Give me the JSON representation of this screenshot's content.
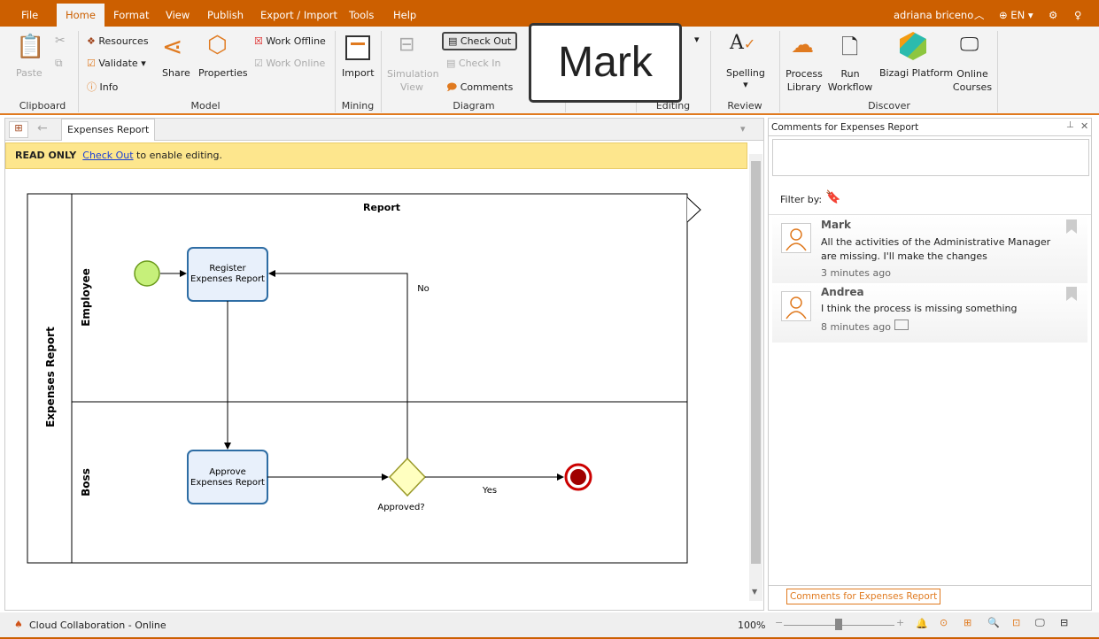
{
  "menu": {
    "file": "File",
    "tabs": [
      "Home",
      "Format",
      "View",
      "Publish",
      "Export / Import",
      "Tools",
      "Help"
    ],
    "user": "adriana briceno",
    "language": "EN"
  },
  "ribbon": {
    "paste": "Paste",
    "clipboard_group": "Clipboard",
    "resources": "Resources",
    "validate": "Validate",
    "info": "Info",
    "share": "Share",
    "properties": "Properties",
    "work_offline": "Work Offline",
    "work_online": "Work Online",
    "model_group": "Model",
    "import": "Import",
    "mining_group": "Mining",
    "simulation_view": "Simulation View",
    "check_out": "Check Out",
    "check_in": "Check In",
    "comments": "Comments",
    "diagram_group": "Diagram",
    "editing_group": "Editing",
    "spelling": "Spelling",
    "review_group": "Review",
    "process_library": "Process Library",
    "run_workflow": "Run Workflow",
    "bizagi_platform": "Bizagi Platform",
    "online_courses": "Online Courses",
    "discover_group": "Discover"
  },
  "tooltip": {
    "text": "Mark"
  },
  "document": {
    "tab": "Expenses Report",
    "readonly_label": "READ ONLY",
    "readonly_link": "Check Out",
    "readonly_suffix": " to enable editing."
  },
  "diagram": {
    "pool": "Expenses Report",
    "header": "Report",
    "lanes": [
      "Employee",
      "Boss"
    ],
    "task1": [
      "Register",
      "Expenses Report"
    ],
    "task2": [
      "Approve",
      "Expenses Report"
    ],
    "gateway": "Approved?",
    "no": "No",
    "yes": "Yes"
  },
  "comments_panel": {
    "title": "Comments for Expenses Report",
    "filter_label": "Filter by:",
    "items": [
      {
        "author": "Mark",
        "text": "All the activities of the Administrative Manager are missing. I'll make the changes",
        "time": "3 minutes ago"
      },
      {
        "author": "Andrea",
        "text": "I think the process is missing something",
        "time": "8 minutes ago"
      }
    ],
    "bottom_tab": "Comments for Expenses Report"
  },
  "status": {
    "cloud": "Cloud Collaboration - Online",
    "zoom": "100%",
    "zoom_level": 100
  },
  "colors": {
    "brand": "#cc5f00",
    "readonly_bg": "#fde68d",
    "task_fill": "#e8f0fb",
    "task_border": "#2e6da4",
    "start": "#c6f07a",
    "end": "#a00000",
    "gateway": "#ffffc0"
  }
}
